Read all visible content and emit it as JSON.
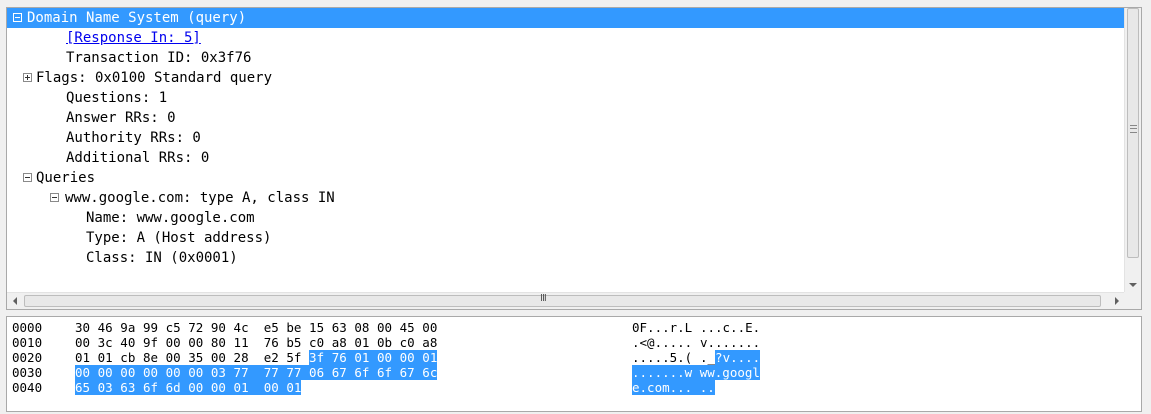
{
  "colors": {
    "selection": "#3399ff",
    "link": "#0000ee",
    "pane_border": "#a9a9a9"
  },
  "tree": [
    {
      "text": "Domain Name System (query)",
      "indent": 0,
      "expander": "minus",
      "selected": true,
      "link": false
    },
    {
      "text": "[Response In: 5]",
      "indent": 2,
      "expander": null,
      "selected": false,
      "link": true
    },
    {
      "text": "Transaction ID: 0x3f76",
      "indent": 2,
      "expander": null,
      "selected": false,
      "link": false
    },
    {
      "text": "Flags: 0x0100 Standard query",
      "indent": 1,
      "expander": "plus",
      "selected": false,
      "link": false
    },
    {
      "text": "Questions: 1",
      "indent": 2,
      "expander": null,
      "selected": false,
      "link": false
    },
    {
      "text": "Answer RRs: 0",
      "indent": 2,
      "expander": null,
      "selected": false,
      "link": false
    },
    {
      "text": "Authority RRs: 0",
      "indent": 2,
      "expander": null,
      "selected": false,
      "link": false
    },
    {
      "text": "Additional RRs: 0",
      "indent": 2,
      "expander": null,
      "selected": false,
      "link": false
    },
    {
      "text": "Queries",
      "indent": 1,
      "expander": "minus",
      "selected": false,
      "link": false
    },
    {
      "text": "www.google.com: type A, class IN",
      "indent": 2,
      "expander": "minus",
      "selected": false,
      "link": false
    },
    {
      "text": "Name: www.google.com",
      "indent": 3,
      "expander": null,
      "selected": false,
      "link": false
    },
    {
      "text": "Type: A (Host address)",
      "indent": 3,
      "expander": null,
      "selected": false,
      "link": false
    },
    {
      "text": "Class: IN (0x0001)",
      "indent": 3,
      "expander": null,
      "selected": false,
      "link": false
    }
  ],
  "hscroll_grip": "III",
  "hex_rows": [
    {
      "offset": "0000",
      "bytes": [
        "30",
        "46",
        "9a",
        "99",
        "c5",
        "72",
        "90",
        "4c",
        "e5",
        "be",
        "15",
        "63",
        "08",
        "00",
        "45",
        "00"
      ],
      "ascii": [
        {
          "t": "0F...r.L",
          "hl": false
        },
        {
          "t": " ",
          "hl": false
        },
        {
          "t": "...c..E.",
          "hl": false
        }
      ],
      "hl_from": -1
    },
    {
      "offset": "0010",
      "bytes": [
        "00",
        "3c",
        "40",
        "9f",
        "00",
        "00",
        "80",
        "11",
        "76",
        "b5",
        "c0",
        "a8",
        "01",
        "0b",
        "c0",
        "a8"
      ],
      "ascii": [
        {
          "t": ".<@.....",
          "hl": false
        },
        {
          "t": " ",
          "hl": false
        },
        {
          "t": "v.......",
          "hl": false
        }
      ],
      "hl_from": -1
    },
    {
      "offset": "0020",
      "bytes": [
        "01",
        "01",
        "cb",
        "8e",
        "00",
        "35",
        "00",
        "28",
        "e2",
        "5f",
        "3f",
        "76",
        "01",
        "00",
        "00",
        "01"
      ],
      "ascii": [
        {
          "t": ".....5.(",
          "hl": false
        },
        {
          "t": " ",
          "hl": false
        },
        {
          "t": "._",
          "hl": false
        },
        {
          "t": "?v....",
          "hl": true
        }
      ],
      "hl_from": 10
    },
    {
      "offset": "0030",
      "bytes": [
        "00",
        "00",
        "00",
        "00",
        "00",
        "00",
        "03",
        "77",
        "77",
        "77",
        "06",
        "67",
        "6f",
        "6f",
        "67",
        "6c"
      ],
      "ascii": [
        {
          "t": ".......w ww.googl",
          "hl": true
        }
      ],
      "hl_from": 0
    },
    {
      "offset": "0040",
      "bytes": [
        "65",
        "03",
        "63",
        "6f",
        "6d",
        "00",
        "00",
        "01",
        "00",
        "01"
      ],
      "ascii": [
        {
          "t": "e.com... ..",
          "hl": true
        }
      ],
      "hl_from": 0
    }
  ]
}
